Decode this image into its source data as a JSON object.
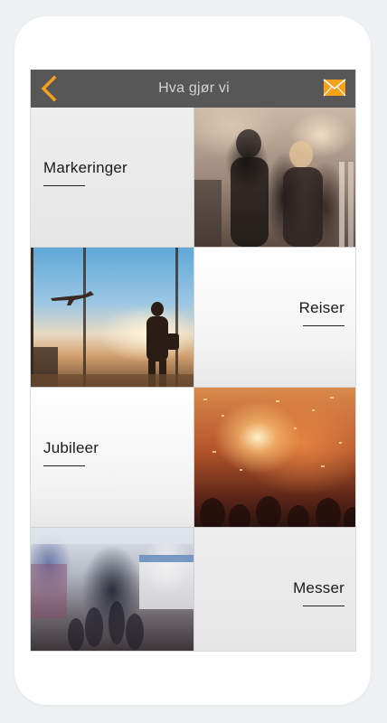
{
  "header": {
    "title": "Hva gjør vi",
    "back_icon": "chevron-left-icon",
    "mail_icon": "envelope-icon",
    "accent_color": "#f6a11a",
    "bar_color": "#575757"
  },
  "tiles": [
    {
      "label": "Markeringer",
      "image": "party-photo"
    },
    {
      "label": "Reiser",
      "image": "airport-travel-photo"
    },
    {
      "label": "Jubileer",
      "image": "confetti-concert-photo"
    },
    {
      "label": "Messer",
      "image": "trade-fair-photo"
    }
  ]
}
